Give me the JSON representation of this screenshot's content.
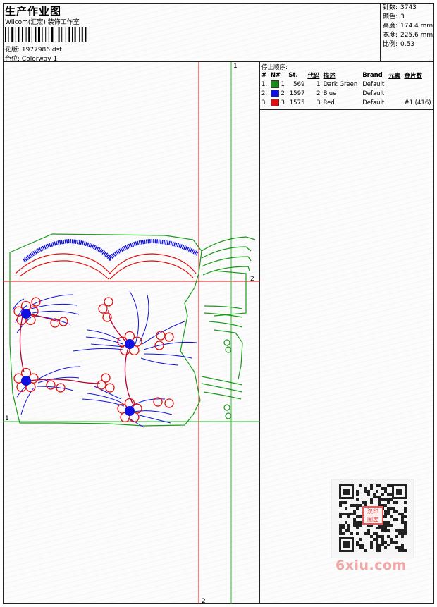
{
  "header": {
    "title": "生产作业图",
    "company": "Wilcom(汇宏) 装饰工作室",
    "design_label": "花版:",
    "design_value": "1977986.dst",
    "color_label": "色位:",
    "color_value": "Colorway 1"
  },
  "stats": {
    "stitches_label": "针数:",
    "stitches_value": "3743",
    "colors_label": "颜色:",
    "colors_value": "3",
    "height_label": "高度:",
    "height_value": "174.4 mm",
    "width_label": "宽度:",
    "width_value": "225.6 mm",
    "scale_label": "比例:",
    "scale_value": "0.53"
  },
  "stop_sequence": {
    "title": "停止顺序:",
    "headers": [
      "#",
      "N#",
      "St.",
      "代码",
      "描述",
      "Brand",
      "元素",
      "金片数"
    ],
    "rows": [
      {
        "num": "1.",
        "n": "1",
        "swatch": "#1a8a1a",
        "st": "569",
        "code": "1",
        "desc": "Dark Green",
        "brand": "Default",
        "element": "",
        "sequins": ""
      },
      {
        "num": "2.",
        "n": "2",
        "swatch": "#1010e0",
        "st": "1597",
        "code": "2",
        "desc": "Blue",
        "brand": "Default",
        "element": "",
        "sequins": ""
      },
      {
        "num": "3.",
        "n": "3",
        "swatch": "#e01010",
        "st": "1575",
        "code": "3",
        "desc": "Red",
        "brand": "Default",
        "element": "",
        "sequins": "#1 (416)"
      }
    ]
  },
  "guides": {
    "red_h_label": "2",
    "red_v_label": "2",
    "green_h_label": "1",
    "green_v_label": "1"
  },
  "colors": {
    "green": "#1a9a1a",
    "blue": "#1010e0",
    "red": "#e01010",
    "guide_red": "#e01010",
    "guide_green": "#22c022"
  },
  "watermark": {
    "site": "6xiu.com",
    "stamp": "汉印 图库"
  }
}
